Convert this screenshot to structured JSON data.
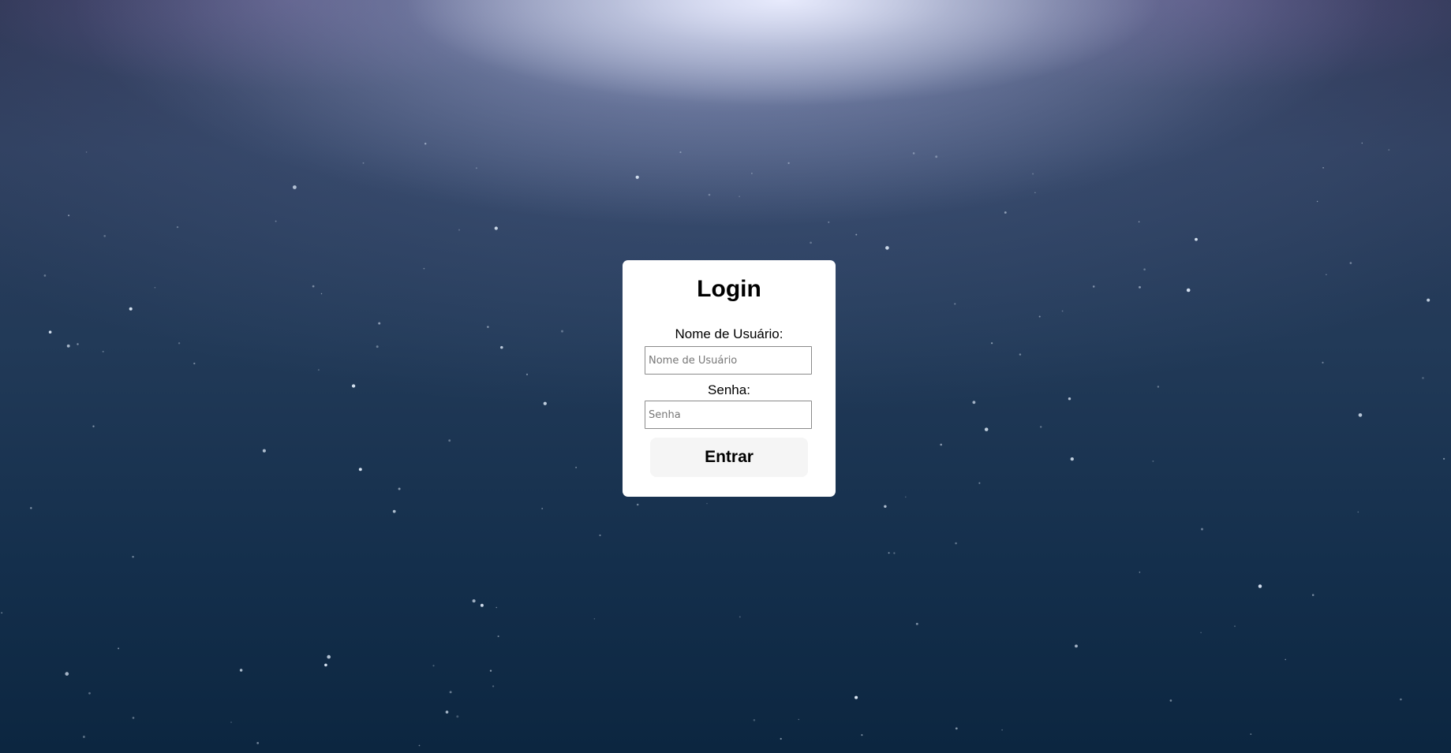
{
  "login": {
    "title": "Login",
    "username": {
      "label": "Nome de Usuário:",
      "placeholder": "Nome de Usuário",
      "value": ""
    },
    "password": {
      "label": "Senha:",
      "placeholder": "Senha",
      "value": ""
    },
    "submit_label": "Entrar"
  },
  "colors": {
    "card_background": "#ffffff",
    "button_background": "#f5f5f5",
    "background_top": "#2b2f4c",
    "background_bottom": "#0c2640"
  }
}
